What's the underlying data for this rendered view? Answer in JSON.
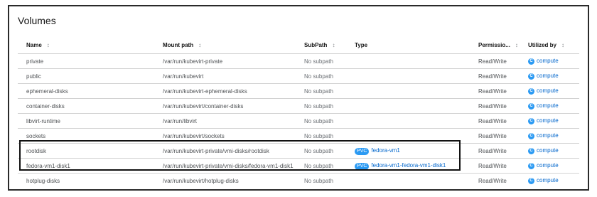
{
  "title": "Volumes",
  "columns": [
    {
      "label": "Name",
      "sort": "↕"
    },
    {
      "label": "Mount path",
      "sort": "↕"
    },
    {
      "label": "SubPath",
      "sort": "↕"
    },
    {
      "label": "Type",
      "sort": ""
    },
    {
      "label": "Permissio...",
      "sort": "↕"
    },
    {
      "label": "Utilized by",
      "sort": "↕"
    }
  ],
  "icon_glyph": "C",
  "rows": [
    {
      "name": "private",
      "mount": "/var/run/kubevirt-private",
      "subpath": "No subpath",
      "type_badge": "",
      "type_link": "",
      "perm": "Read/Write",
      "used_by": "compute"
    },
    {
      "name": "public",
      "mount": "/var/run/kubevirt",
      "subpath": "No subpath",
      "type_badge": "",
      "type_link": "",
      "perm": "Read/Write",
      "used_by": "compute"
    },
    {
      "name": "ephemeral-disks",
      "mount": "/var/run/kubevirt-ephemeral-disks",
      "subpath": "No subpath",
      "type_badge": "",
      "type_link": "",
      "perm": "Read/Write",
      "used_by": "compute"
    },
    {
      "name": "container-disks",
      "mount": "/var/run/kubevirt/container-disks",
      "subpath": "No subpath",
      "type_badge": "",
      "type_link": "",
      "perm": "Read/Write",
      "used_by": "compute"
    },
    {
      "name": "libvirt-runtime",
      "mount": "/var/run/libvirt",
      "subpath": "No subpath",
      "type_badge": "",
      "type_link": "",
      "perm": "Read/Write",
      "used_by": "compute"
    },
    {
      "name": "sockets",
      "mount": "/var/run/kubevirt/sockets",
      "subpath": "No subpath",
      "type_badge": "",
      "type_link": "",
      "perm": "Read/Write",
      "used_by": "compute"
    },
    {
      "name": "rootdisk",
      "mount": "/var/run/kubevirt-private/vmi-disks/rootdisk",
      "subpath": "No subpath",
      "type_badge": "PVC",
      "type_link": "fedora-vm1",
      "perm": "Read/Write",
      "used_by": "compute"
    },
    {
      "name": "fedora-vm1-disk1",
      "mount": "/var/run/kubevirt-private/vmi-disks/fedora-vm1-disk1",
      "subpath": "No subpath",
      "type_badge": "PVC",
      "type_link": "fedora-vm1-fedora-vm1-disk1",
      "perm": "Read/Write",
      "used_by": "compute"
    },
    {
      "name": "hotplug-disks",
      "mount": "/var/run/kubevirt/hotplug-disks",
      "subpath": "No subpath",
      "type_badge": "",
      "type_link": "",
      "perm": "Read/Write",
      "used_by": "compute"
    }
  ]
}
